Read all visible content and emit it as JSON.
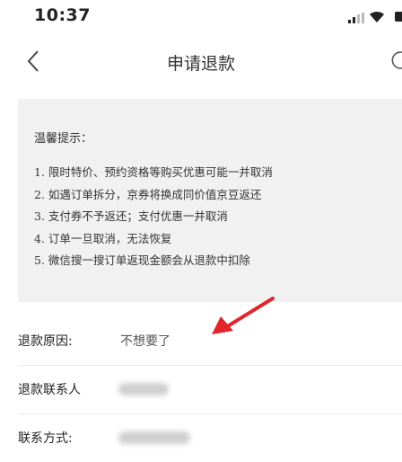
{
  "status_bar": {
    "time": "10:37"
  },
  "nav": {
    "title": "申请退款"
  },
  "notice": {
    "title": "温馨提示：",
    "items": [
      "1. 限时特价、预约资格等购买优惠可能一并取消",
      "2. 如遇订单拆分，京券将换成同价值京豆返还",
      "3. 支付券不予返还；支付优惠一并取消",
      "4. 订单一旦取消，无法恢复",
      "5. 微信搜一搜订单返现金额会从退款中扣除"
    ]
  },
  "form": {
    "reason_label": "退款原因:",
    "reason_value": "不想要了",
    "contact_label": "退款联系人",
    "phone_label": "联系方式:"
  },
  "colors": {
    "annotation_arrow": "#e0262c",
    "notice_bg": "#f1f1f1"
  }
}
